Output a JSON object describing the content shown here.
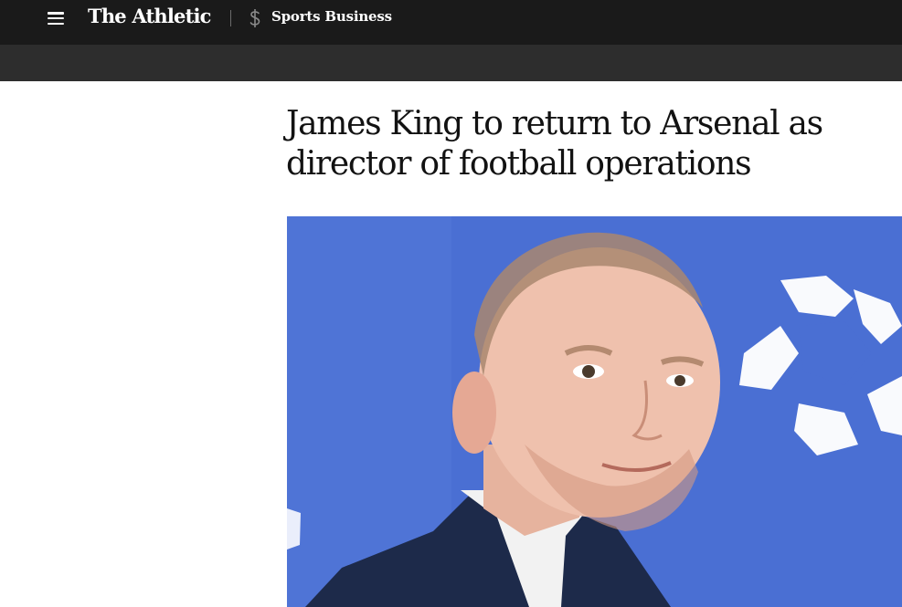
{
  "header": {
    "logo_text": "The Athletic",
    "section_label": "Sports Business",
    "menu_icon": "hamburger-menu-icon",
    "section_icon": "dollar-sign-icon",
    "background_color": "#1a1a1a",
    "subbar_color": "#2d2d2d"
  },
  "article": {
    "headline": "James King to return to Arsenal as director of football operations"
  },
  "hero_image": {
    "background_color": "#4a6fd3"
  }
}
